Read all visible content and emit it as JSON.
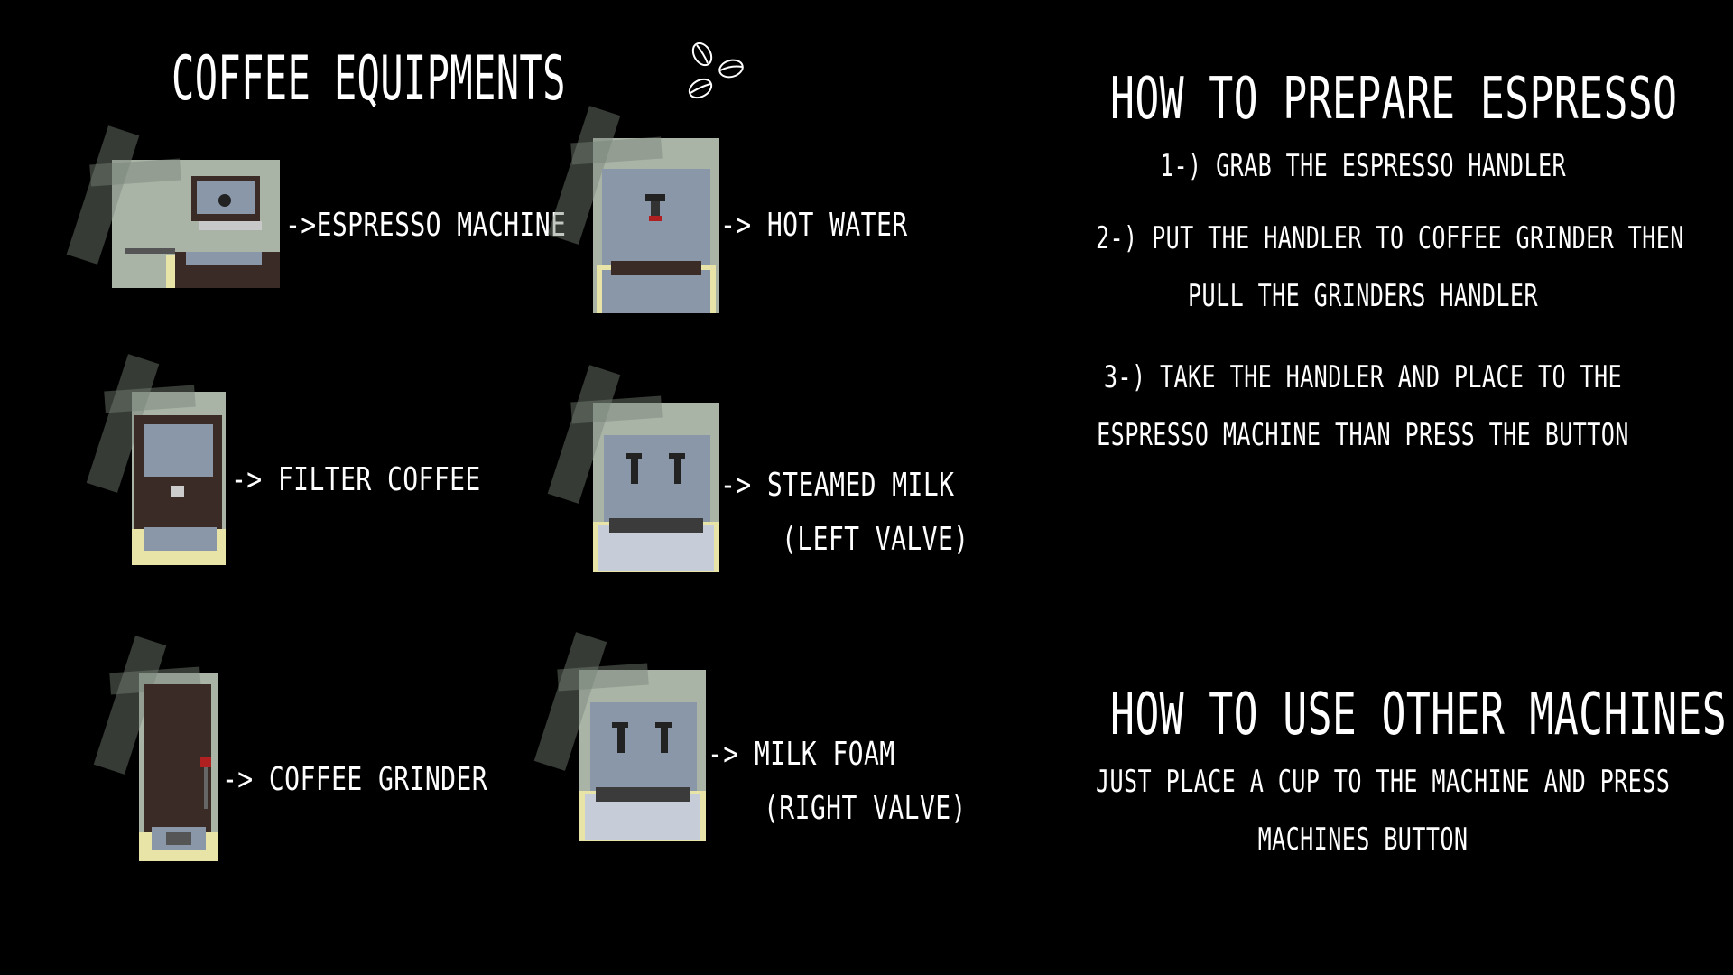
{
  "equipment_section": {
    "title": "COFFEE EQUIPMENTS",
    "icon": "coffee-beans-icon",
    "items": [
      {
        "id": "espresso-machine",
        "label": "->ESPRESSO MACHINE"
      },
      {
        "id": "hot-water",
        "label": "-> HOT WATER"
      },
      {
        "id": "filter-coffee",
        "label": "-> FILTER COFFEE"
      },
      {
        "id": "steamed-milk",
        "label": "-> STEAMED MILK",
        "label2": "(LEFT VALVE)"
      },
      {
        "id": "coffee-grinder",
        "label": "-> COFFEE GRINDER"
      },
      {
        "id": "milk-foam",
        "label": "-> MILK FOAM",
        "label2": "(RIGHT VALVE)"
      }
    ]
  },
  "espresso_section": {
    "title": "HOW TO PREPARE ESPRESSO",
    "steps": [
      "1-) GRAB THE ESPRESSO HANDLER",
      "2-) PUT THE HANDLER TO COFFEE GRINDER THEN",
      "PULL THE GRINDERS HANDLER",
      "3-) TAKE THE HANDLER AND PLACE TO THE",
      "ESPRESSO MACHINE THAN PRESS THE BUTTON"
    ]
  },
  "other_section": {
    "title": "HOW TO USE OTHER MACHINES",
    "lines": [
      "JUST PLACE A CUP TO THE MACHINE AND PRESS",
      "MACHINES BUTTON"
    ]
  },
  "colors": {
    "background": "#000000",
    "text": "#ffffff",
    "machine_gray": "#8a97a8",
    "machine_dark": "#3a2b25",
    "counter": "#e8e4a8",
    "scene_bg": "#a9b3a6"
  }
}
